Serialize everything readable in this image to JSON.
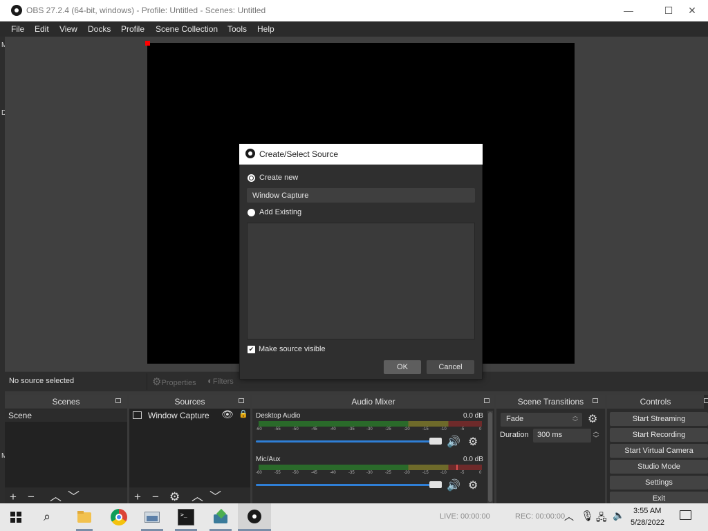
{
  "window": {
    "title": "OBS 27.2.4 (64-bit, windows) - Profile: Untitled - Scenes: Untitled",
    "minimize": "—",
    "maximize": "☐",
    "close": "✕"
  },
  "menu": [
    "File",
    "Edit",
    "View",
    "Docks",
    "Profile",
    "Scene Collection",
    "Tools",
    "Help"
  ],
  "left_strip_letters": [
    "M",
    "D",
    "M"
  ],
  "context_bar": {
    "status": "No source selected",
    "properties": "Properties",
    "filters": "Filters"
  },
  "docks": {
    "scenes": {
      "title": "Scenes",
      "items": [
        "Scene"
      ]
    },
    "sources": {
      "title": "Sources",
      "items": [
        "Window Capture"
      ]
    },
    "mixer": {
      "title": "Audio Mixer",
      "ticks": [
        "-60",
        "-55",
        "-50",
        "-45",
        "-40",
        "-35",
        "-30",
        "-25",
        "-20",
        "-15",
        "-10",
        "-5",
        "0"
      ],
      "channels": [
        {
          "name": "Desktop Audio",
          "db": "0.0 dB",
          "volume": 1.0
        },
        {
          "name": "Mic/Aux",
          "db": "0.0 dB",
          "volume": 1.0
        }
      ]
    },
    "transitions": {
      "title": "Scene Transitions",
      "selected": "Fade",
      "duration_label": "Duration",
      "duration_value": "300 ms"
    },
    "controls": {
      "title": "Controls",
      "buttons": [
        "Start Streaming",
        "Start Recording",
        "Start Virtual Camera",
        "Studio Mode",
        "Settings",
        "Exit"
      ]
    }
  },
  "dialog": {
    "title": "Create/Select Source",
    "create_new_label": "Create new",
    "name_value": "Window Capture",
    "add_existing_label": "Add Existing",
    "visible_label": "Make source visible",
    "ok": "OK",
    "cancel": "Cancel"
  },
  "taskbar": {
    "status_live": "LIVE: 00:00:00",
    "status_rec": "REC: 00:00:00",
    "time": "3:55 AM",
    "date": "5/28/2022"
  },
  "colors": {
    "accent": "#2f7fd6",
    "preview_handle": "#ff0000",
    "meter_green": "#2a6a2a",
    "meter_yellow": "#6e6a2a",
    "meter_red": "#6e2a2a"
  },
  "icons": [
    "obs-logo-icon",
    "eye-icon",
    "lock-icon",
    "gear-icon",
    "speaker-icon",
    "plus-icon",
    "minus-icon",
    "chevron-up-icon",
    "chevron-down-icon",
    "windows-start-icon",
    "search-icon",
    "file-explorer-icon",
    "chrome-icon",
    "terminal-icon",
    "notification-icon"
  ]
}
